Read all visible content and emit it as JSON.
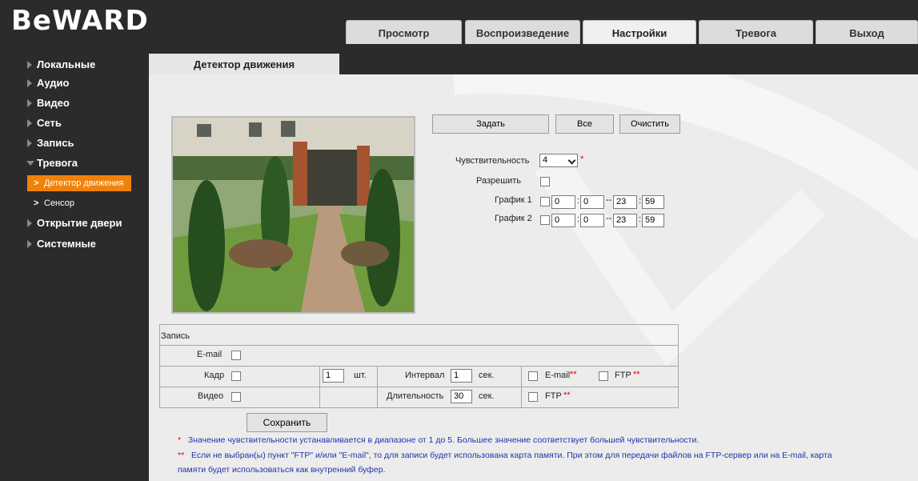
{
  "brand": {
    "logo_text": "BeWARD"
  },
  "nav": {
    "tabs": [
      {
        "label": "Просмотр",
        "active": false
      },
      {
        "label": "Воспроизведение",
        "active": false
      },
      {
        "label": "Настройки",
        "active": true
      },
      {
        "label": "Тревога",
        "active": false
      },
      {
        "label": "Выход",
        "active": false
      }
    ]
  },
  "sidebar": {
    "items": [
      {
        "label": "Локальные",
        "expanded": false
      },
      {
        "label": "Аудио",
        "expanded": false
      },
      {
        "label": "Видео",
        "expanded": false
      },
      {
        "label": "Сеть",
        "expanded": false
      },
      {
        "label": "Запись",
        "expanded": false
      },
      {
        "label": "Тревога",
        "expanded": true
      },
      {
        "label": "Открытие двери",
        "expanded": false
      },
      {
        "label": "Системные",
        "expanded": false
      }
    ],
    "subitems": [
      {
        "label": "Детектор движения",
        "active": true
      },
      {
        "label": "Сенсор",
        "active": false
      }
    ]
  },
  "page": {
    "title": "Детектор движения"
  },
  "area_buttons": {
    "set": "Задать",
    "all": "Все",
    "clear": "Очистить"
  },
  "sensitivity": {
    "label": "Чувствительность",
    "value": "4",
    "marker": "*"
  },
  "enable": {
    "label": "Разрешить",
    "checked": false
  },
  "schedule": [
    {
      "label": "График 1",
      "checked": false,
      "start_h": "0",
      "start_m": "0",
      "end_h": "23",
      "end_m": "59"
    },
    {
      "label": "График 2",
      "checked": false,
      "start_h": "0",
      "start_m": "0",
      "end_h": "23",
      "end_m": "59"
    }
  ],
  "record": {
    "title": "Запись",
    "email_label": "E-mail",
    "frame_label": "Кадр",
    "frame_count": "1",
    "frame_unit": "шт.",
    "interval_label": "Интервал",
    "interval_value": "1",
    "interval_unit": "сек.",
    "frame_email_label": "E-mail",
    "frame_ftp_label": "FTP",
    "video_label": "Видео",
    "duration_label": "Длительность",
    "duration_value": "30",
    "duration_unit": "сек.",
    "video_ftp_label": "FTP",
    "marker": "**"
  },
  "save_button": "Сохранить",
  "notes": {
    "star1": "*",
    "line1": "Значение чувствительности устанавливается в диапазоне от 1 до 5. Большее значение соответствует большей чувствительности.",
    "star2": "**",
    "line2": "Если не выбран(ы) пункт \"FTP\" и/или \"E-mail\", то для записи будет использована карта памяти. При этом для передачи файлов на FTP-сервер или на E-mail, карта",
    "line3": "памяти будет использоваться как внутренний буфер."
  }
}
